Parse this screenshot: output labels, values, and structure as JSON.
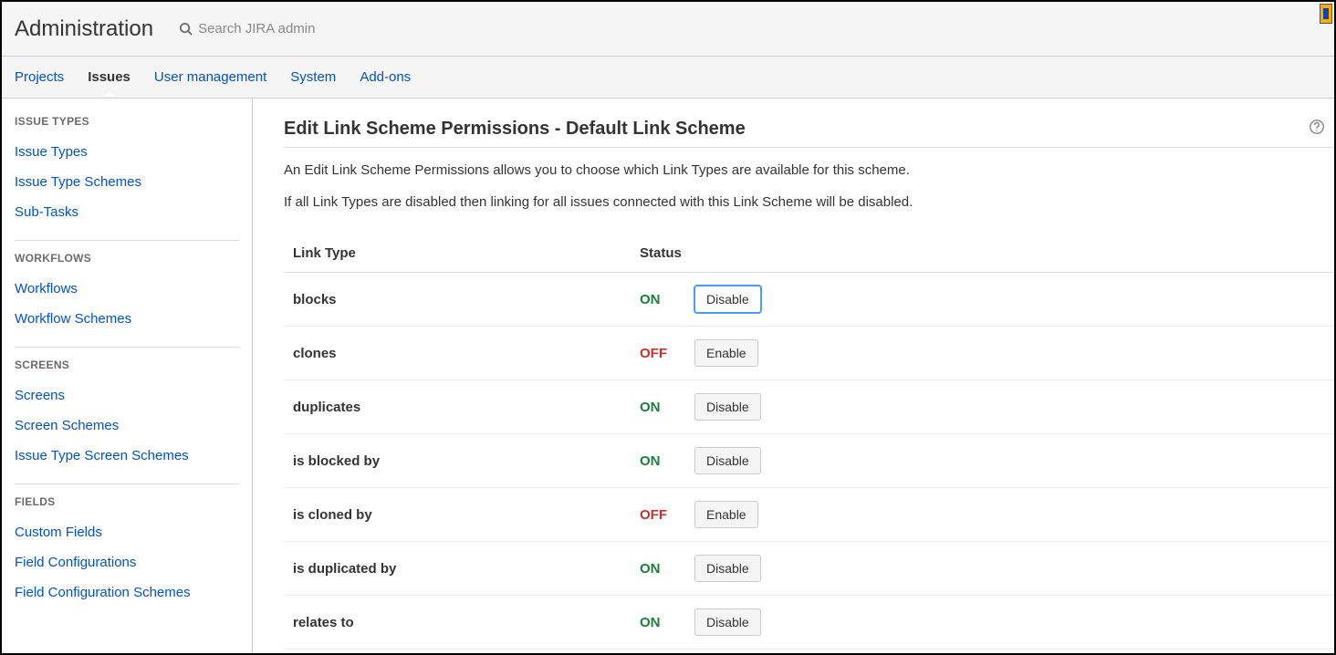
{
  "header": {
    "title": "Administration",
    "search_placeholder": "Search JIRA admin"
  },
  "nav": {
    "tabs": [
      {
        "label": "Projects",
        "active": false
      },
      {
        "label": "Issues",
        "active": true
      },
      {
        "label": "User management",
        "active": false
      },
      {
        "label": "System",
        "active": false
      },
      {
        "label": "Add-ons",
        "active": false
      }
    ]
  },
  "sidebar": {
    "sections": [
      {
        "heading": "ISSUE TYPES",
        "items": [
          "Issue Types",
          "Issue Type Schemes",
          "Sub-Tasks"
        ]
      },
      {
        "heading": "WORKFLOWS",
        "items": [
          "Workflows",
          "Workflow Schemes"
        ]
      },
      {
        "heading": "SCREENS",
        "items": [
          "Screens",
          "Screen Schemes",
          "Issue Type Screen Schemes"
        ]
      },
      {
        "heading": "FIELDS",
        "items": [
          "Custom Fields",
          "Field Configurations",
          "Field Configuration Schemes"
        ]
      }
    ]
  },
  "main": {
    "title": "Edit Link Scheme Permissions - Default Link Scheme",
    "desc1": "An Edit Link Scheme Permissions allows you to choose which Link Types are available for this scheme.",
    "desc2": "If all Link Types are disabled then linking for all issues connected with this Link Scheme will be disabled.",
    "columns": {
      "name": "Link Type",
      "status": "Status"
    },
    "status_labels": {
      "on": "ON",
      "off": "OFF"
    },
    "action_labels": {
      "enable": "Enable",
      "disable": "Disable"
    },
    "rows": [
      {
        "name": "blocks",
        "on": true,
        "focused": true
      },
      {
        "name": "clones",
        "on": false
      },
      {
        "name": "duplicates",
        "on": true
      },
      {
        "name": "is blocked by",
        "on": true
      },
      {
        "name": "is cloned by",
        "on": false
      },
      {
        "name": "is duplicated by",
        "on": true
      },
      {
        "name": "relates to",
        "on": true
      }
    ]
  }
}
